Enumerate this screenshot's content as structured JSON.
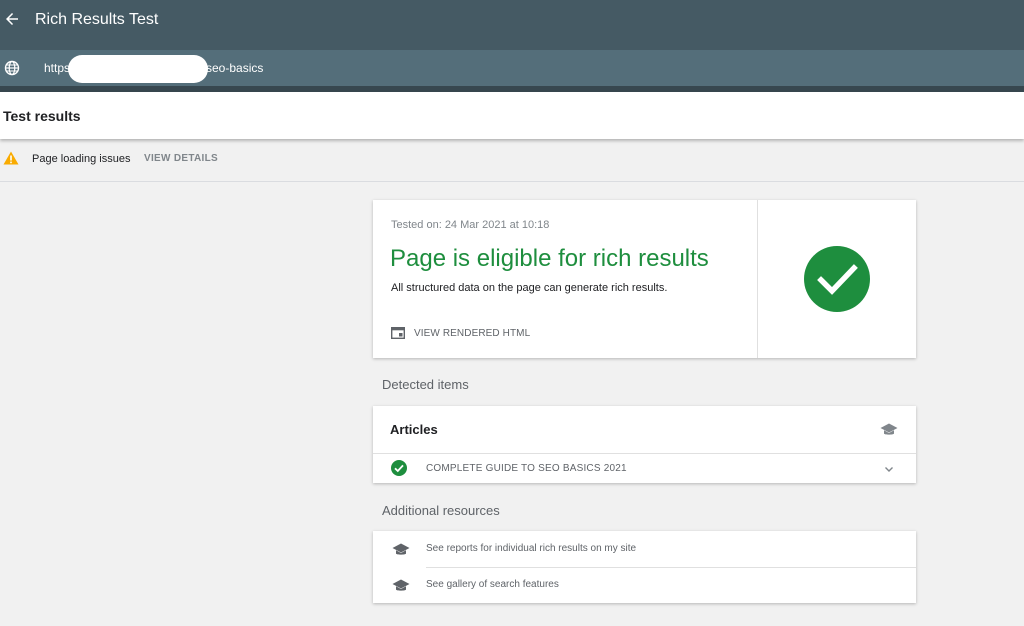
{
  "header": {
    "title": "Rich Results Test"
  },
  "url_bar": {
    "prefix": "https:",
    "suffix": "seo-basics"
  },
  "results": {
    "title": "Test results"
  },
  "warning": {
    "text": "Page loading issues",
    "action": "VIEW DETAILS"
  },
  "summary": {
    "tested_on": "Tested on: 24 Mar 2021 at 10:18",
    "status": "Page is eligible for rich results",
    "description": "All structured data on the page can generate rich results.",
    "view_html": "VIEW RENDERED HTML",
    "status_color": "#1e8e3e"
  },
  "detected": {
    "label": "Detected items",
    "card_title": "Articles",
    "items": [
      {
        "name": "COMPLETE GUIDE TO SEO BASICS 2021"
      }
    ]
  },
  "additional": {
    "label": "Additional resources",
    "links": [
      {
        "text": "See reports for individual rich results on my site"
      },
      {
        "text": "See gallery of search features"
      }
    ]
  },
  "icons": {
    "back": "arrow-left-icon",
    "globe": "globe-icon",
    "warning": "warning-triangle-icon",
    "html": "code-window-icon",
    "success": "check-circle-icon",
    "resource": "graduation-cap-icon",
    "expand": "chevron-down-icon"
  },
  "colors": {
    "topbar": "#455a64",
    "urlbar": "#546e7a",
    "success": "#1e8e3e",
    "warning": "#f9ab00"
  }
}
